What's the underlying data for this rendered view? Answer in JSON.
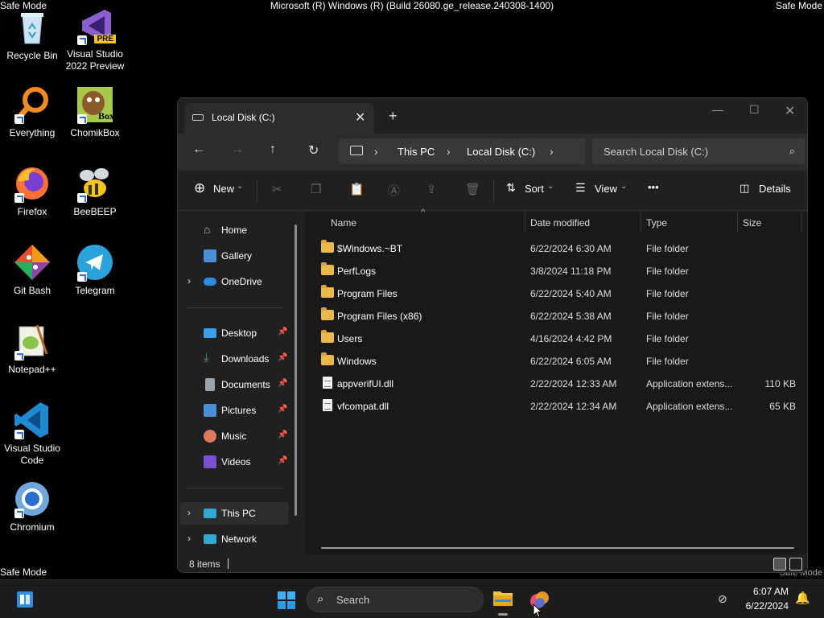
{
  "screen": {
    "safe_mode": "Safe Mode",
    "build": "Microsoft (R) Windows (R) (Build 26080.ge_release.240308-1400)"
  },
  "desktop_icons": [
    {
      "label": "Recycle Bin",
      "icon": "recycle-bin-icon"
    },
    {
      "label": "Visual Studio 2022 Preview",
      "icon": "visual-studio-preview-icon",
      "badge": "PRE"
    },
    {
      "label": "Everything",
      "icon": "everything-search-icon"
    },
    {
      "label": "ChomikBox",
      "icon": "chomikbox-icon",
      "badge": "Box"
    },
    {
      "label": "Firefox",
      "icon": "firefox-icon"
    },
    {
      "label": "BeeBEEP",
      "icon": "beebeep-icon"
    },
    {
      "label": "Git Bash",
      "icon": "git-bash-icon"
    },
    {
      "label": "Telegram",
      "icon": "telegram-icon"
    },
    {
      "label": "Notepad++",
      "icon": "notepad-plus-plus-icon"
    },
    {
      "label": "Visual Studio Code",
      "icon": "vscode-icon"
    },
    {
      "label": "Chromium",
      "icon": "chromium-icon"
    }
  ],
  "explorer": {
    "tab_title": "Local Disk (C:)",
    "breadcrumbs": [
      "This PC",
      "Local Disk (C:)"
    ],
    "search_placeholder": "Search Local Disk (C:)",
    "commands": {
      "new": "New",
      "sort": "Sort",
      "view": "View",
      "more": "•••",
      "details": "Details"
    },
    "sidebar": {
      "top": [
        {
          "label": "Home",
          "icon": "home-icon"
        },
        {
          "label": "Gallery",
          "icon": "gallery-icon"
        },
        {
          "label": "OneDrive",
          "icon": "onedrive-icon"
        }
      ],
      "quick": [
        {
          "label": "Desktop",
          "icon": "desktop-folder-icon"
        },
        {
          "label": "Downloads",
          "icon": "downloads-icon"
        },
        {
          "label": "Documents",
          "icon": "documents-icon"
        },
        {
          "label": "Pictures",
          "icon": "pictures-icon"
        },
        {
          "label": "Music",
          "icon": "music-icon"
        },
        {
          "label": "Videos",
          "icon": "videos-icon"
        }
      ],
      "bottom": [
        {
          "label": "This PC",
          "icon": "this-pc-icon"
        },
        {
          "label": "Network",
          "icon": "network-icon"
        }
      ]
    },
    "columns": {
      "name": "Name",
      "date": "Date modified",
      "type": "Type",
      "size": "Size"
    },
    "files": [
      {
        "name": "$Windows.~BT",
        "date": "6/22/2024 6:30 AM",
        "type": "File folder",
        "size": "",
        "kind": "folder"
      },
      {
        "name": "PerfLogs",
        "date": "3/8/2024 11:18 PM",
        "type": "File folder",
        "size": "",
        "kind": "folder"
      },
      {
        "name": "Program Files",
        "date": "6/22/2024 5:40 AM",
        "type": "File folder",
        "size": "",
        "kind": "folder"
      },
      {
        "name": "Program Files (x86)",
        "date": "6/22/2024 5:38 AM",
        "type": "File folder",
        "size": "",
        "kind": "folder"
      },
      {
        "name": "Users",
        "date": "4/16/2024 4:42 PM",
        "type": "File folder",
        "size": "",
        "kind": "folder"
      },
      {
        "name": "Windows",
        "date": "6/22/2024 6:05 AM",
        "type": "File folder",
        "size": "",
        "kind": "folder"
      },
      {
        "name": "appverifUI.dll",
        "date": "2/22/2024 12:33 AM",
        "type": "Application extens...",
        "size": "110 KB",
        "kind": "dll"
      },
      {
        "name": "vfcompat.dll",
        "date": "2/22/2024 12:34 AM",
        "type": "Application extens...",
        "size": "65 KB",
        "kind": "dll"
      }
    ],
    "status": "8 items"
  },
  "taskbar": {
    "search_label": "Search",
    "time": "6:07 AM",
    "date": "6/22/2024"
  }
}
